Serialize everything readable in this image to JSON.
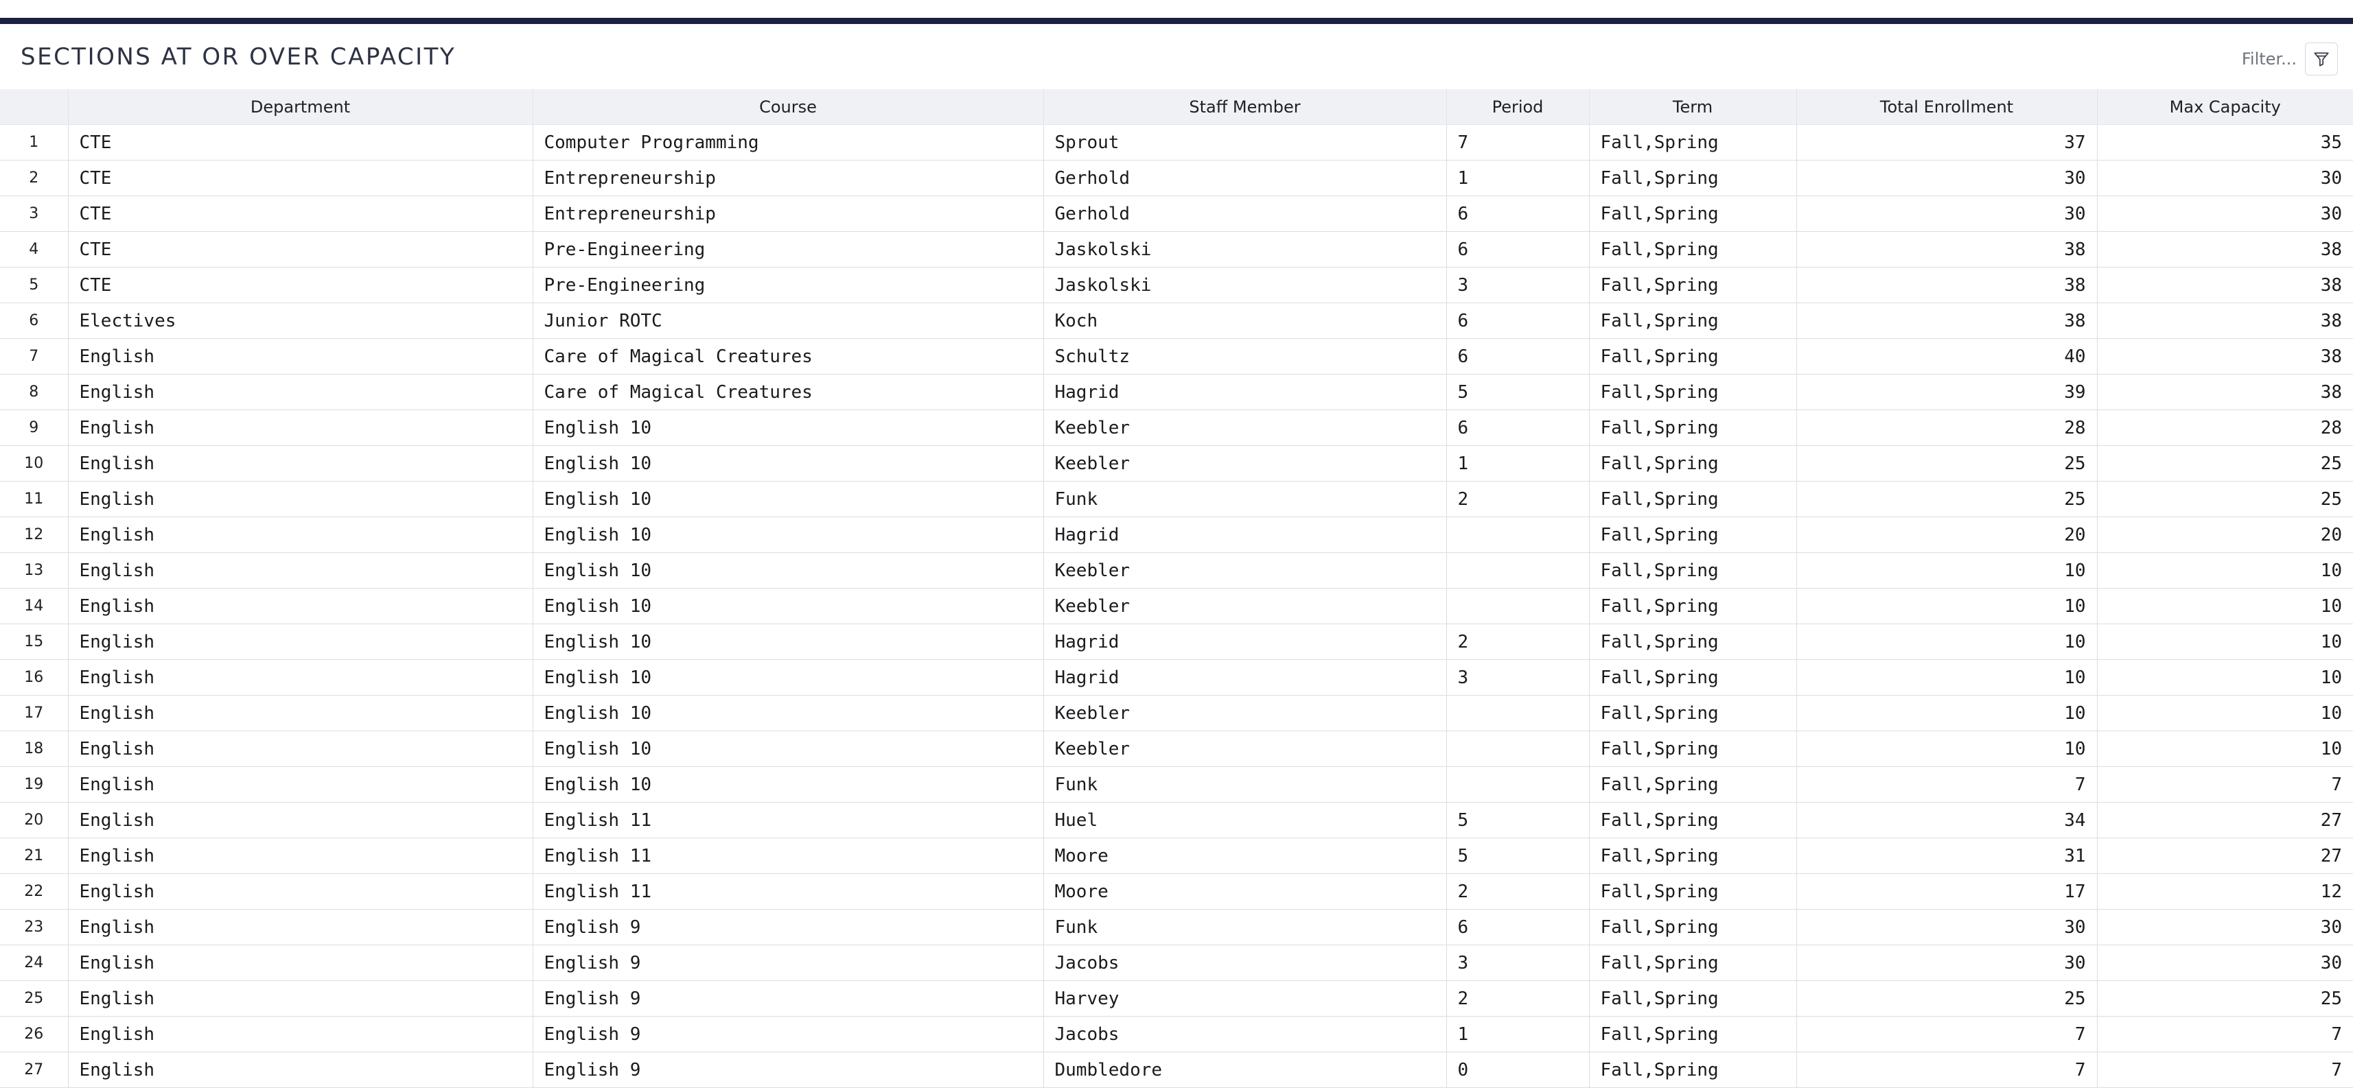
{
  "header": {
    "title": "SECTIONS AT OR OVER CAPACITY",
    "filter_label": "Filter...",
    "filter_icon": "funnel-icon"
  },
  "table": {
    "columns": [
      "",
      "Department",
      "Course",
      "Staff Member",
      "Period",
      "Term",
      "Total Enrollment",
      "Max Capacity"
    ],
    "rows": [
      {
        "n": "1",
        "dept": "CTE",
        "course": "Computer Programming",
        "staff": "Sprout",
        "period": "7",
        "term": "Fall,Spring",
        "enroll": "37",
        "cap": "35"
      },
      {
        "n": "2",
        "dept": "CTE",
        "course": "Entrepreneurship",
        "staff": "Gerhold",
        "period": "1",
        "term": "Fall,Spring",
        "enroll": "30",
        "cap": "30"
      },
      {
        "n": "3",
        "dept": "CTE",
        "course": "Entrepreneurship",
        "staff": "Gerhold",
        "period": "6",
        "term": "Fall,Spring",
        "enroll": "30",
        "cap": "30"
      },
      {
        "n": "4",
        "dept": "CTE",
        "course": "Pre-Engineering",
        "staff": "Jaskolski",
        "period": "6",
        "term": "Fall,Spring",
        "enroll": "38",
        "cap": "38"
      },
      {
        "n": "5",
        "dept": "CTE",
        "course": "Pre-Engineering",
        "staff": "Jaskolski",
        "period": "3",
        "term": "Fall,Spring",
        "enroll": "38",
        "cap": "38"
      },
      {
        "n": "6",
        "dept": "Electives",
        "course": "Junior ROTC",
        "staff": "Koch",
        "period": "6",
        "term": "Fall,Spring",
        "enroll": "38",
        "cap": "38"
      },
      {
        "n": "7",
        "dept": "English",
        "course": "Care of Magical Creatures",
        "staff": "Schultz",
        "period": "6",
        "term": "Fall,Spring",
        "enroll": "40",
        "cap": "38"
      },
      {
        "n": "8",
        "dept": "English",
        "course": "Care of Magical Creatures",
        "staff": "Hagrid",
        "period": "5",
        "term": "Fall,Spring",
        "enroll": "39",
        "cap": "38"
      },
      {
        "n": "9",
        "dept": "English",
        "course": "English 10",
        "staff": "Keebler",
        "period": "6",
        "term": "Fall,Spring",
        "enroll": "28",
        "cap": "28"
      },
      {
        "n": "10",
        "dept": "English",
        "course": "English 10",
        "staff": "Keebler",
        "period": "1",
        "term": "Fall,Spring",
        "enroll": "25",
        "cap": "25"
      },
      {
        "n": "11",
        "dept": "English",
        "course": "English 10",
        "staff": "Funk",
        "period": "2",
        "term": "Fall,Spring",
        "enroll": "25",
        "cap": "25"
      },
      {
        "n": "12",
        "dept": "English",
        "course": "English 10",
        "staff": "Hagrid",
        "period": "",
        "term": "Fall,Spring",
        "enroll": "20",
        "cap": "20"
      },
      {
        "n": "13",
        "dept": "English",
        "course": "English 10",
        "staff": "Keebler",
        "period": "",
        "term": "Fall,Spring",
        "enroll": "10",
        "cap": "10"
      },
      {
        "n": "14",
        "dept": "English",
        "course": "English 10",
        "staff": "Keebler",
        "period": "",
        "term": "Fall,Spring",
        "enroll": "10",
        "cap": "10"
      },
      {
        "n": "15",
        "dept": "English",
        "course": "English 10",
        "staff": "Hagrid",
        "period": "2",
        "term": "Fall,Spring",
        "enroll": "10",
        "cap": "10"
      },
      {
        "n": "16",
        "dept": "English",
        "course": "English 10",
        "staff": "Hagrid",
        "period": "3",
        "term": "Fall,Spring",
        "enroll": "10",
        "cap": "10"
      },
      {
        "n": "17",
        "dept": "English",
        "course": "English 10",
        "staff": "Keebler",
        "period": "",
        "term": "Fall,Spring",
        "enroll": "10",
        "cap": "10"
      },
      {
        "n": "18",
        "dept": "English",
        "course": "English 10",
        "staff": "Keebler",
        "period": "",
        "term": "Fall,Spring",
        "enroll": "10",
        "cap": "10"
      },
      {
        "n": "19",
        "dept": "English",
        "course": "English 10",
        "staff": "Funk",
        "period": "",
        "term": "Fall,Spring",
        "enroll": "7",
        "cap": "7"
      },
      {
        "n": "20",
        "dept": "English",
        "course": "English 11",
        "staff": "Huel",
        "period": "5",
        "term": "Fall,Spring",
        "enroll": "34",
        "cap": "27"
      },
      {
        "n": "21",
        "dept": "English",
        "course": "English 11",
        "staff": "Moore",
        "period": "5",
        "term": "Fall,Spring",
        "enroll": "31",
        "cap": "27"
      },
      {
        "n": "22",
        "dept": "English",
        "course": "English 11",
        "staff": "Moore",
        "period": "2",
        "term": "Fall,Spring",
        "enroll": "17",
        "cap": "12"
      },
      {
        "n": "23",
        "dept": "English",
        "course": "English 9",
        "staff": "Funk",
        "period": "6",
        "term": "Fall,Spring",
        "enroll": "30",
        "cap": "30"
      },
      {
        "n": "24",
        "dept": "English",
        "course": "English 9",
        "staff": "Jacobs",
        "period": "3",
        "term": "Fall,Spring",
        "enroll": "30",
        "cap": "30"
      },
      {
        "n": "25",
        "dept": "English",
        "course": "English 9",
        "staff": "Harvey",
        "period": "2",
        "term": "Fall,Spring",
        "enroll": "25",
        "cap": "25"
      },
      {
        "n": "26",
        "dept": "English",
        "course": "English 9",
        "staff": "Jacobs",
        "period": "1",
        "term": "Fall,Spring",
        "enroll": "7",
        "cap": "7"
      },
      {
        "n": "27",
        "dept": "English",
        "course": "English 9",
        "staff": "Dumbledore",
        "period": "0",
        "term": "Fall,Spring",
        "enroll": "7",
        "cap": "7"
      }
    ]
  }
}
